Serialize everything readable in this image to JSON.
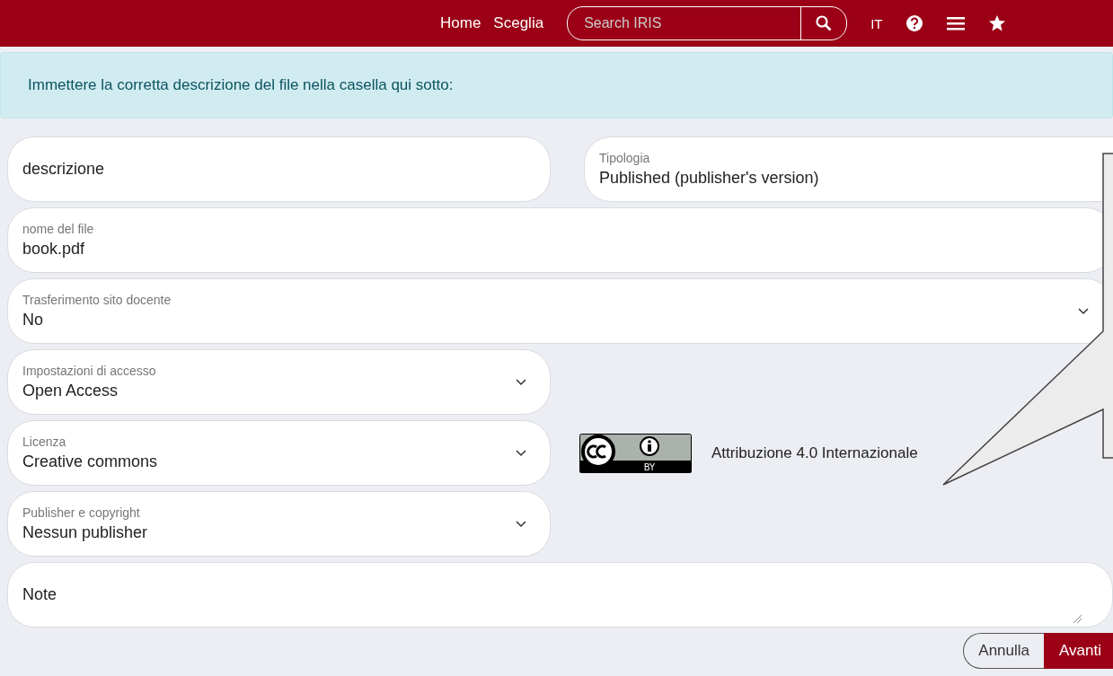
{
  "header": {
    "nav": [
      "Home",
      "Sceglia"
    ],
    "search": {
      "placeholder": "Search IRIS"
    },
    "language": "IT"
  },
  "alert": "Immettere la corretta descrizione del file nella casella qui sotto:",
  "rows": [
    {
      "fields": [
        {
          "kind": "text",
          "placeholder": "descrizione",
          "full_width": false
        },
        {
          "kind": "select",
          "label": "Tipologia",
          "value": "Published (publisher's version)",
          "full_width": false
        }
      ]
    },
    {
      "fields": [
        {
          "kind": "text",
          "label": "nome del file",
          "value": "book.pdf",
          "full_width": true
        }
      ]
    },
    {
      "fields": [
        {
          "kind": "select",
          "label": "Trasferimento sito docente",
          "value": "No",
          "full_width": true
        }
      ]
    },
    {
      "fields": [
        {
          "kind": "select",
          "label": "Impostazioni di accesso",
          "value": "Open Access",
          "full_width": false
        }
      ]
    },
    {
      "fields": [
        {
          "kind": "select",
          "label": "Licenza",
          "value": "Creative commons",
          "full_width": false
        }
      ],
      "license": {
        "badge": "BY",
        "text": "Attribuzione 4.0 Internazionale"
      }
    },
    {
      "fields": [
        {
          "kind": "select",
          "label": "Publisher e copyright",
          "value": "Nessun publisher",
          "full_width": false
        }
      ]
    },
    {
      "fields": [
        {
          "kind": "textarea",
          "placeholder": "Note",
          "full_width": true
        }
      ]
    }
  ],
  "buttons": [
    {
      "label": "Annulla",
      "kind": "secondary"
    },
    {
      "label": "Avanti",
      "kind": "primary"
    }
  ]
}
